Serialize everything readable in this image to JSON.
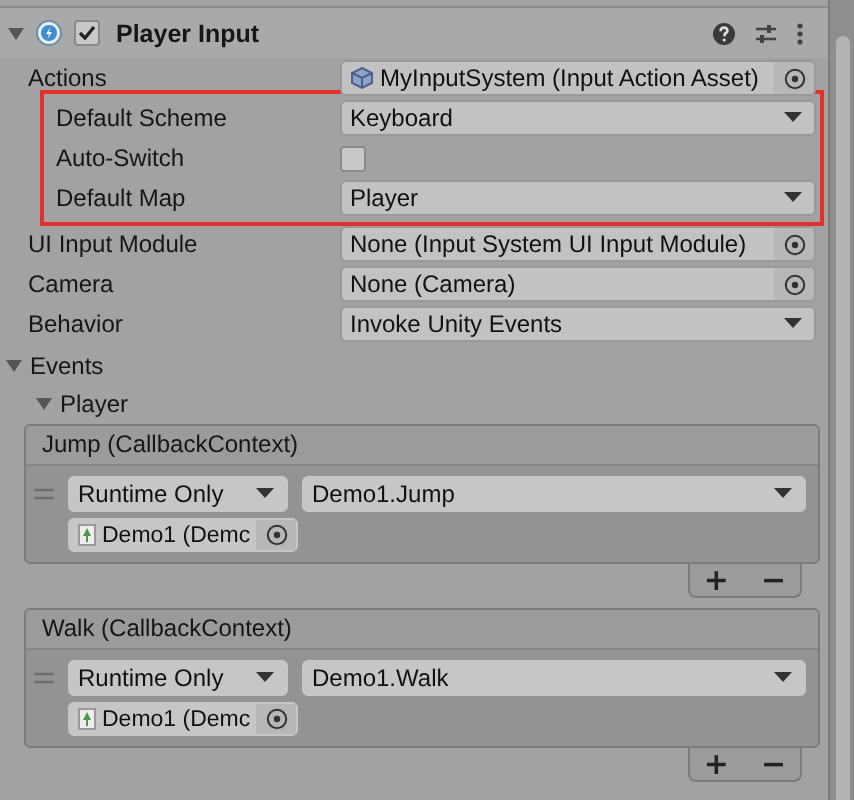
{
  "component": {
    "title": "Player Input",
    "expanded": true,
    "enabled": true
  },
  "properties": [
    {
      "kind": "asset",
      "label": "Actions",
      "value": "MyInputSystem (Input Action Asset)",
      "children_highlighted": true,
      "children": [
        {
          "kind": "dropdown",
          "label": "Default Scheme",
          "value": "Keyboard"
        },
        {
          "kind": "checkbox",
          "label": "Auto-Switch",
          "checked": false
        },
        {
          "kind": "dropdown",
          "label": "Default Map",
          "value": "Player"
        }
      ]
    },
    {
      "kind": "object",
      "label": "UI Input Module",
      "value": "None (Input System UI Input Module)"
    },
    {
      "kind": "object",
      "label": "Camera",
      "value": "None (Camera)"
    },
    {
      "kind": "dropdown",
      "label": "Behavior",
      "value": "Invoke Unity Events"
    }
  ],
  "events": {
    "label": "Events",
    "expanded": true,
    "groups": [
      {
        "label": "Player",
        "expanded": true,
        "items": [
          {
            "title": "Jump (CallbackContext)",
            "listeners": [
              {
                "mode": "Runtime Only",
                "function": "Demo1.Jump",
                "target": "Demo1 (Demc"
              }
            ],
            "add": "+",
            "remove": "−"
          },
          {
            "title": "Walk (CallbackContext)",
            "listeners": [
              {
                "mode": "Runtime Only",
                "function": "Demo1.Walk",
                "target": "Demo1 (Demc"
              }
            ],
            "add": "+",
            "remove": "−"
          }
        ]
      }
    ]
  }
}
